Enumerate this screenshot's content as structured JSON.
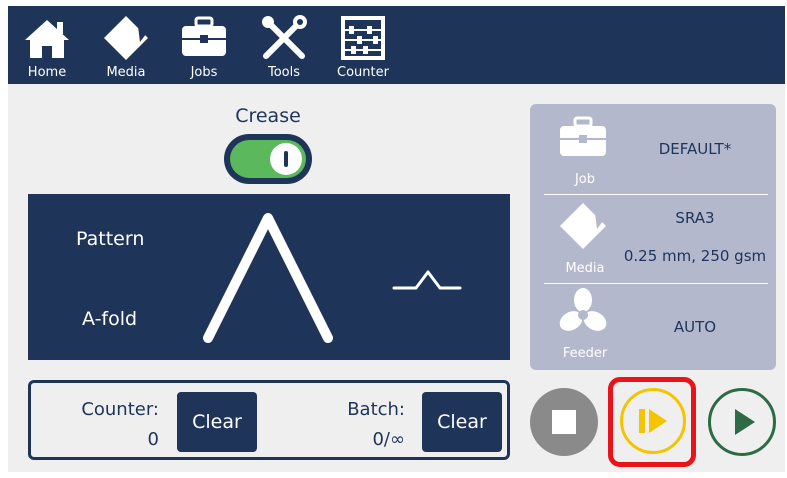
{
  "nav": {
    "items": [
      {
        "label": "Home",
        "icon": "home-icon"
      },
      {
        "label": "Media",
        "icon": "media-icon"
      },
      {
        "label": "Jobs",
        "icon": "briefcase-icon"
      },
      {
        "label": "Tools",
        "icon": "tools-icon"
      },
      {
        "label": "Counter",
        "icon": "abacus-icon"
      }
    ]
  },
  "crease": {
    "label": "Crease",
    "enabled": true
  },
  "pattern": {
    "label": "Pattern",
    "value": "A-fold"
  },
  "info": {
    "job": {
      "caption": "Job",
      "value": "DEFAULT*"
    },
    "media": {
      "caption": "Media",
      "size": "SRA3",
      "spec": "0.25 mm, 250 gsm"
    },
    "feeder": {
      "caption": "Feeder",
      "value": "AUTO"
    }
  },
  "counter": {
    "counter_label": "Counter:",
    "counter_value": "0",
    "batch_label": "Batch:",
    "batch_value": "0/∞",
    "clear_label": "Clear"
  },
  "colors": {
    "navy": "#1f3459",
    "toggle_on": "#5cb85c",
    "panel_grey": "#b3b8cc",
    "step_yellow": "#f5c400",
    "play_green": "#2d6a45",
    "highlight_red": "#e8141a"
  },
  "actions": [
    "stop-icon",
    "single-step-icon",
    "play-icon"
  ]
}
